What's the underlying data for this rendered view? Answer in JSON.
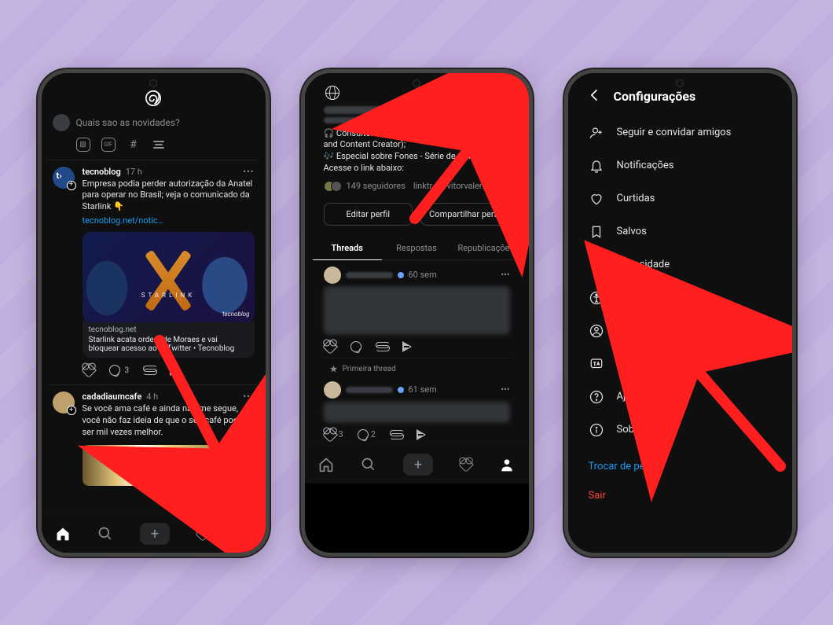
{
  "phone1": {
    "composer_placeholder": "Quais sao as novidades?",
    "post1": {
      "user": "tecnoblog",
      "time": "17 h",
      "body": "Empresa podia perder autorização da Anatel para operar no Brasil; veja o comunicado da Starlink 👇",
      "link": "tecnoblog.net/notic…",
      "card_brand_word": "STARLINK",
      "card_watermark": "tecnoblog",
      "card_domain": "tecnoblog.net",
      "card_title": "Starlink acata ordem de Moraes e vai bloquear acesso ao X/Twitter • Tecnoblog",
      "comment_count": "3"
    },
    "post2": {
      "user": "cadadiaumcafe",
      "time": "4 h",
      "body": "Se você ama café e ainda não me segue, você não faz ideia de que o seu café pode ser mil vezes melhor."
    }
  },
  "phone2": {
    "bio_line1": "🎧 Consultor e Criador do Conteúdo (Consultant and Content Creator);",
    "bio_line2": "🎶 Especial sobre Fones - Série de artigos. Acesse o link abaixo:",
    "followers": "149 seguidores",
    "followers_link": "linktr.ee/vitorvaleri",
    "btn_edit": "Editar perfil",
    "btn_share": "Compartilhar perfil",
    "tabs": {
      "threads": "Threads",
      "replies": "Respostas",
      "reposts": "Republicações"
    },
    "post_a_time": "60 sem",
    "post_a_c1": "3",
    "post_a_c2": "2",
    "primeira": "Primeira thread",
    "post_b_time": "61 sem"
  },
  "phone3": {
    "title": "Configurações",
    "items": {
      "follow": "Seguir e convidar amigos",
      "notif": "Notificações",
      "likes": "Curtidas",
      "saved": "Salvos",
      "privacy": "Privacidade",
      "access": "Acessibilidade",
      "account": "Conta",
      "language": "Idioma",
      "help": "Ajuda",
      "about": "Sobre"
    },
    "switch_profile": "Trocar de perfil",
    "logout": "Sair"
  }
}
